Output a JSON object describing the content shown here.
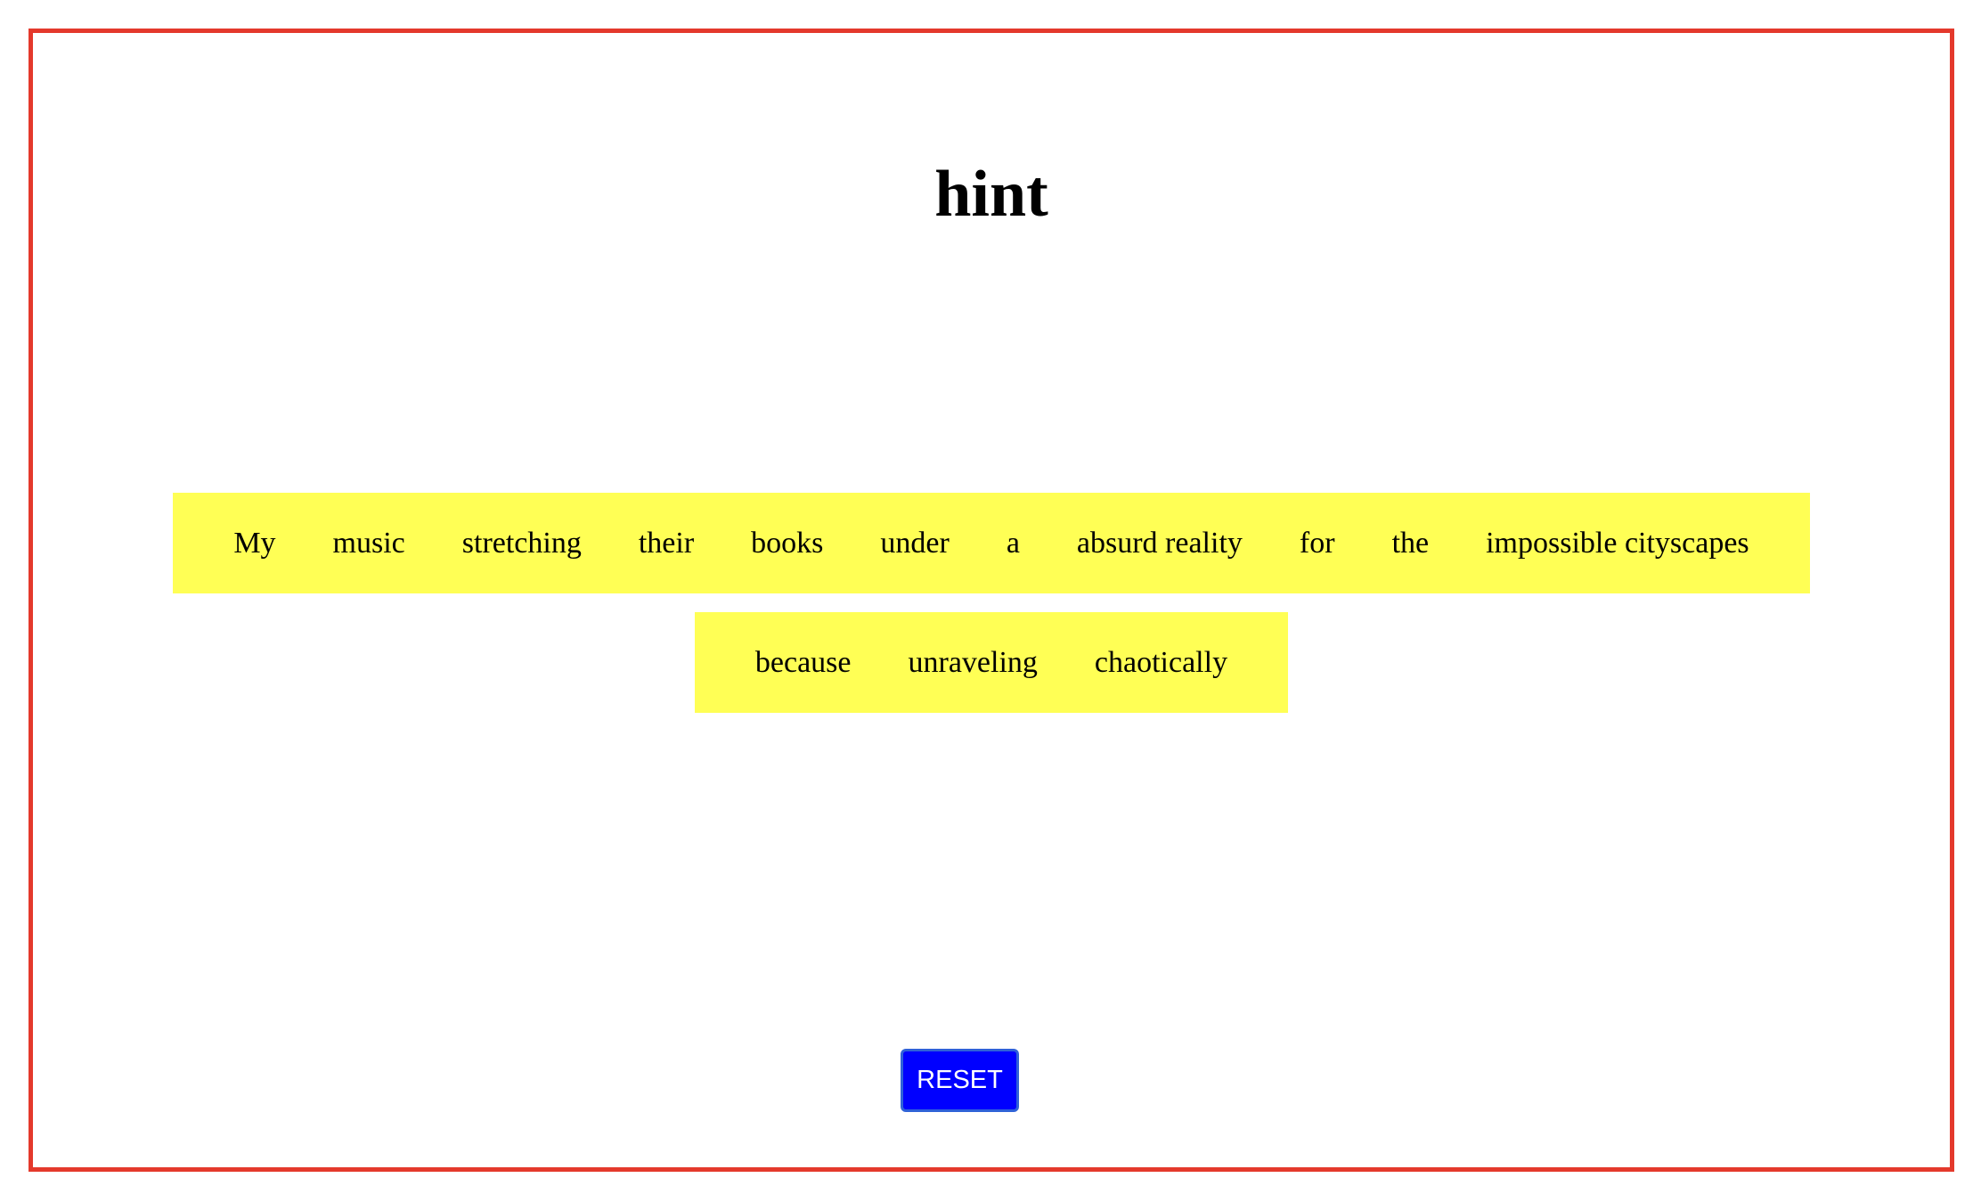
{
  "title": "hint",
  "words_row1": [
    "My",
    "music",
    "stretching",
    "their",
    "books",
    "under",
    "a",
    "absurd reality",
    "for",
    "the",
    "impossible cityscapes"
  ],
  "words_row2": [
    "because",
    "unraveling",
    "chaotically"
  ],
  "reset_label": "RESET",
  "colors": {
    "frame_border": "#e4392c",
    "word_box_bg": "#ffff55",
    "button_bg": "#0000ff",
    "button_text": "#ffffff"
  }
}
